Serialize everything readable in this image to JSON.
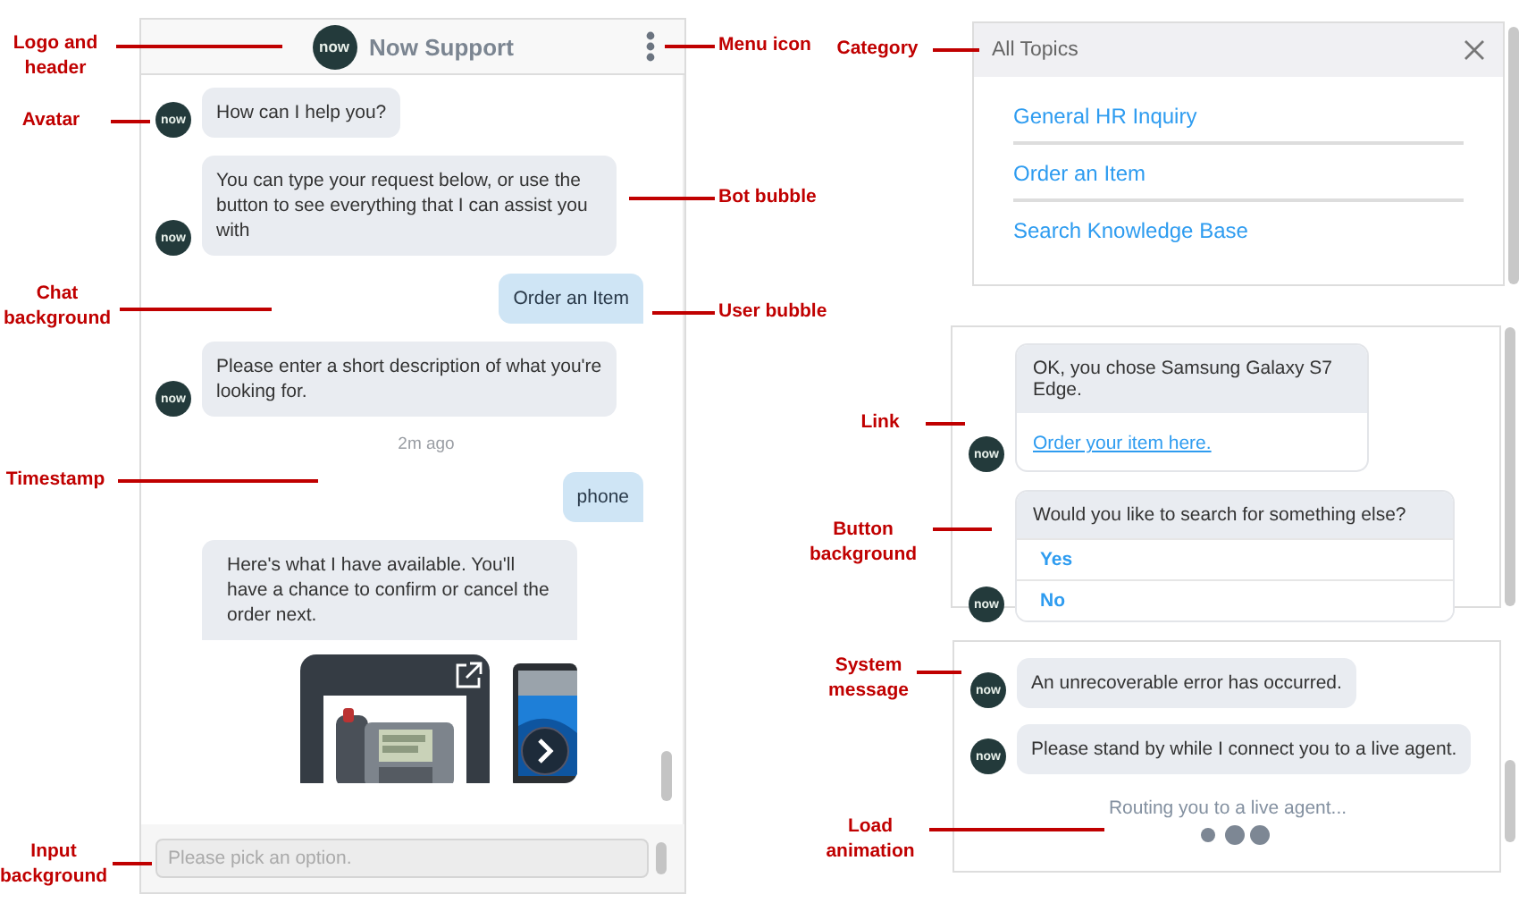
{
  "annotations": [
    {
      "label": "Logo and header"
    },
    {
      "label": "Avatar"
    },
    {
      "label": "Chat background"
    },
    {
      "label": "Timestamp"
    },
    {
      "label": "Input background"
    },
    {
      "label": "Menu icon"
    },
    {
      "label": "Bot bubble"
    },
    {
      "label": "User bubble"
    },
    {
      "label": "Category"
    },
    {
      "label": "Link"
    },
    {
      "label": "Button background"
    },
    {
      "label": "System message"
    },
    {
      "label": "Load animation"
    }
  ],
  "chat": {
    "title": "Now Support",
    "logo": "now",
    "messages": [
      {
        "kind": "bot",
        "avatar": "now",
        "text": "How can I help you?"
      },
      {
        "kind": "bot",
        "avatar": "now",
        "text": "You can type your request below, or use the button to see everything that I can assist you with"
      },
      {
        "kind": "user",
        "text": "Order an Item"
      },
      {
        "kind": "bot",
        "avatar": "now",
        "text": "Please enter a short description of what you're looking for."
      },
      {
        "kind": "timestamp",
        "text": "2m ago"
      },
      {
        "kind": "user",
        "text": "phone"
      },
      {
        "kind": "card",
        "text": "Here's what I have available. You'll have a chance to confirm or cancel the order next."
      }
    ],
    "input": {
      "placeholder": "Please pick an option."
    }
  },
  "category_panel": {
    "title": "All Topics",
    "items": [
      "General HR Inquiry",
      "Order an Item",
      "Search Knowledge Base"
    ]
  },
  "link_panel": {
    "messages": [
      {
        "kind": "link",
        "avatar": "now",
        "text": "OK, you chose Samsung Galaxy S7 Edge.",
        "link": "Order your item here."
      },
      {
        "kind": "options",
        "avatar": "now",
        "text": "Would you like to search for something else?",
        "options": [
          "Yes",
          "No"
        ]
      }
    ]
  },
  "agent_panel": {
    "messages": [
      {
        "kind": "bot",
        "avatar": "now",
        "text": "An unrecoverable error has occurred."
      },
      {
        "kind": "bot",
        "avatar": "now",
        "text": "Please stand by while I connect you to a live agent."
      }
    ],
    "loading": "Routing you to a live agent..."
  }
}
